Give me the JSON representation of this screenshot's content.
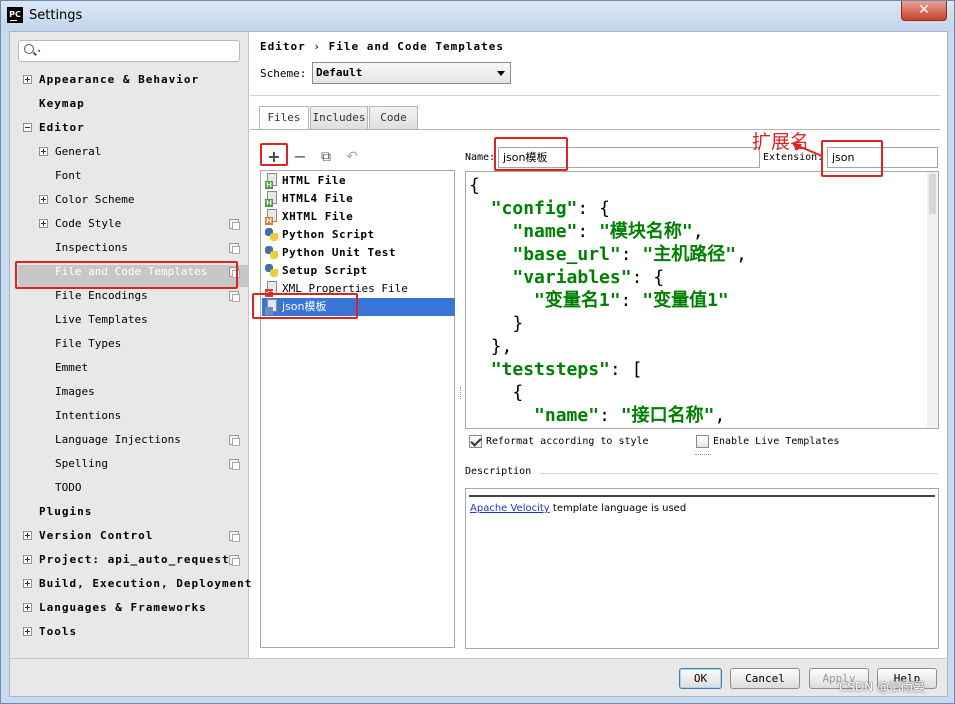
{
  "window": {
    "title": "Settings",
    "close_label": "✕",
    "app_icon_text": "PC"
  },
  "search": {
    "placeholder": ""
  },
  "sidebar": {
    "items": [
      {
        "label": "Appearance & Behavior",
        "bold": true,
        "expander": "plus"
      },
      {
        "label": "Keymap",
        "bold": true
      },
      {
        "label": "Editor",
        "bold": true,
        "expander": "minus"
      },
      {
        "label": "General",
        "expander": "plus"
      },
      {
        "label": "Font"
      },
      {
        "label": "Color Scheme",
        "expander": "plus"
      },
      {
        "label": "Code Style",
        "expander": "plus",
        "project_icon": true
      },
      {
        "label": "Inspections",
        "project_icon": true
      },
      {
        "label": "File and Code Templates",
        "project_icon": true,
        "selected": true
      },
      {
        "label": "File Encodings",
        "project_icon": true
      },
      {
        "label": "Live Templates"
      },
      {
        "label": "File Types"
      },
      {
        "label": "Emmet"
      },
      {
        "label": "Images"
      },
      {
        "label": "Intentions"
      },
      {
        "label": "Language Injections",
        "project_icon": true
      },
      {
        "label": "Spelling",
        "project_icon": true
      },
      {
        "label": "TODO"
      },
      {
        "label": "Plugins",
        "bold": true
      },
      {
        "label": "Version Control",
        "bold": true,
        "expander": "plus",
        "project_icon": true
      },
      {
        "label": "Project: api_auto_requests",
        "bold": true,
        "expander": "plus",
        "project_icon": true
      },
      {
        "label": "Build, Execution, Deployment",
        "bold": true,
        "expander": "plus"
      },
      {
        "label": "Languages & Frameworks",
        "bold": true,
        "expander": "plus"
      },
      {
        "label": "Tools",
        "bold": true,
        "expander": "plus"
      }
    ]
  },
  "breadcrumb": {
    "root": "Editor",
    "separator": "›",
    "page": "File and Code Templates"
  },
  "scheme": {
    "label": "Scheme:",
    "value": "Default"
  },
  "tabs": [
    {
      "label": "Files",
      "active": true
    },
    {
      "label": "Includes"
    },
    {
      "label": "Code"
    }
  ],
  "toolbar": {
    "add": "+",
    "remove": "−",
    "copy": "⧉",
    "reset": "↶"
  },
  "templates": [
    {
      "label": "HTML File",
      "icon": "html-file-icon",
      "badge": "H",
      "badge_color": "green",
      "bold": true
    },
    {
      "label": "HTML4 File",
      "icon": "html4-file-icon",
      "badge": "H",
      "badge_color": "green",
      "bold": true
    },
    {
      "label": "XHTML File",
      "icon": "xhtml-file-icon",
      "badge": "H",
      "badge_color": "orange",
      "bold": true
    },
    {
      "label": "Python Script",
      "icon": "python-icon",
      "bold": true
    },
    {
      "label": "Python Unit Test",
      "icon": "python-icon",
      "bold": true
    },
    {
      "label": "Setup Script",
      "icon": "python-icon",
      "bold": true
    },
    {
      "label": "XML Properties File",
      "icon": "xml-file-icon",
      "badge": "<>",
      "badge_color": "red",
      "bold": false
    },
    {
      "label": "json模板",
      "icon": "json-file-icon",
      "bold": false,
      "selected": true
    }
  ],
  "name_field": {
    "label": "Name:",
    "value": "json模板"
  },
  "extension_field": {
    "label": "Extension:",
    "value": "json"
  },
  "editor": {
    "lines": [
      {
        "indent": "",
        "parts": [
          [
            "p",
            "{"
          ]
        ]
      },
      {
        "indent": "  ",
        "parts": [
          [
            "k",
            "\"config\""
          ],
          [
            "p",
            ": {"
          ]
        ]
      },
      {
        "indent": "    ",
        "parts": [
          [
            "k",
            "\"name\""
          ],
          [
            "p",
            ": "
          ],
          [
            "s",
            "\"模块名称\""
          ],
          [
            "p",
            ","
          ]
        ]
      },
      {
        "indent": "    ",
        "parts": [
          [
            "k",
            "\"base_url\""
          ],
          [
            "p",
            ": "
          ],
          [
            "s",
            "\"主机路径\""
          ],
          [
            "p",
            ","
          ]
        ]
      },
      {
        "indent": "    ",
        "parts": [
          [
            "k",
            "\"variables\""
          ],
          [
            "p",
            ": {"
          ]
        ]
      },
      {
        "indent": "      ",
        "parts": [
          [
            "s",
            "\"变量名1\""
          ],
          [
            "p",
            ": "
          ],
          [
            "s",
            "\"变量值1\""
          ]
        ]
      },
      {
        "indent": "    ",
        "parts": [
          [
            "p",
            "}"
          ]
        ]
      },
      {
        "indent": "  ",
        "parts": [
          [
            "p",
            "},"
          ]
        ]
      },
      {
        "indent": "  ",
        "parts": [
          [
            "k",
            "\"teststeps\""
          ],
          [
            "p",
            ": ["
          ]
        ]
      },
      {
        "indent": "    ",
        "parts": [
          [
            "p",
            "{"
          ]
        ]
      },
      {
        "indent": "      ",
        "parts": [
          [
            "k",
            "\"name\""
          ],
          [
            "p",
            ": "
          ],
          [
            "s",
            "\"接口名称\""
          ],
          [
            "p",
            ","
          ]
        ]
      }
    ]
  },
  "options": {
    "reformat": {
      "label": "Reformat according to style",
      "checked": true
    },
    "live_templates": {
      "label": "Enable Live Templates",
      "checked": false
    }
  },
  "description": {
    "label": "Description",
    "link_text": "Apache Velocity",
    "text": " template language is used"
  },
  "buttons": {
    "ok": "OK",
    "cancel": "Cancel",
    "apply": "Apply",
    "help": "Help"
  },
  "annotation": {
    "text": "扩展名",
    "color": "#e02222"
  },
  "watermark": {
    "text": "CSDN @彭雨晏"
  },
  "colors": {
    "selection": "#3875d7",
    "keyword_green": "#008000",
    "annotation_red": "#e02222",
    "link_blue": "#2234c5"
  }
}
